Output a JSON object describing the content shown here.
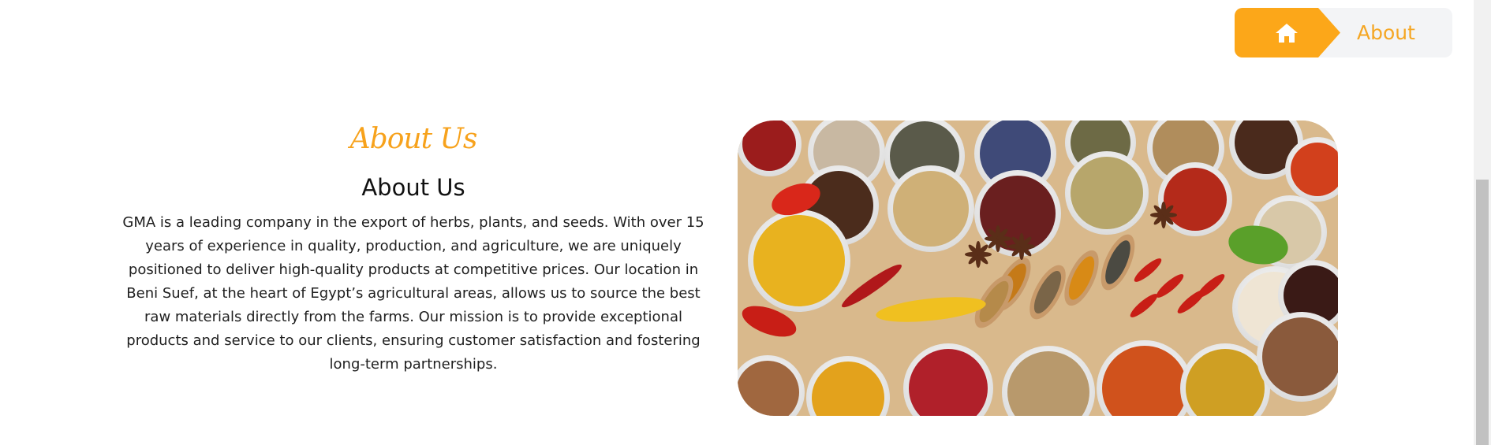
{
  "breadcrumb": {
    "home_icon": "home-icon",
    "current": "About"
  },
  "about": {
    "eyebrow": "About Us",
    "heading": "About Us",
    "body": "GMA is a leading company in the export of herbs, plants, and seeds. With over 15 years of experience in quality, production, and agriculture, we are uniquely positioned to deliver high-quality products at competitive prices. Our location in Beni Suef, at the heart of Egypt’s agricultural areas, allows us to source the best raw materials directly from the farms. Our mission is to provide exceptional products and service to our clients, ensuring customer satisfaction and fostering long-term partnerships."
  },
  "colors": {
    "accent": "#fca719",
    "breadcrumb_bg": "#f3f4f6",
    "text": "#1f1f1f"
  }
}
